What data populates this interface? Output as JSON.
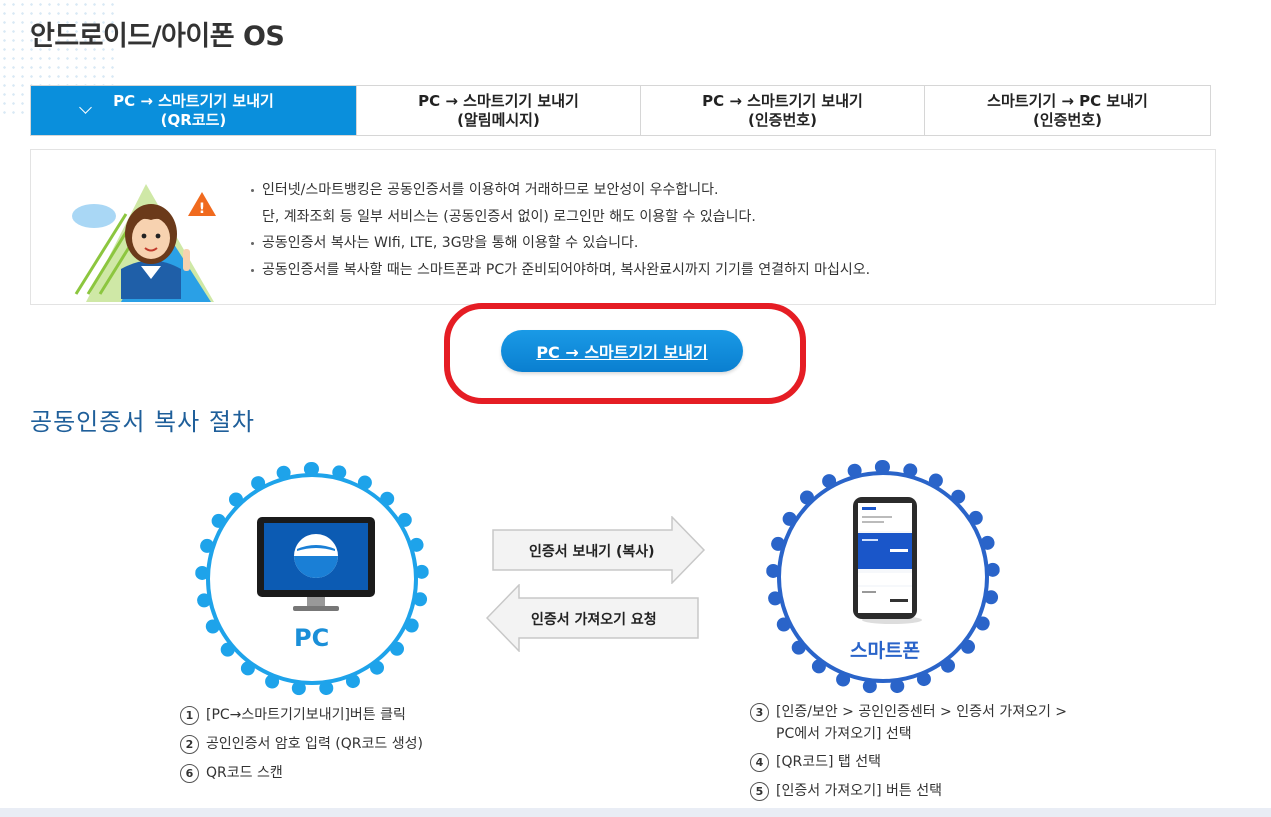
{
  "page_title": "안드로이드/아이폰 OS",
  "tabs": [
    {
      "line1": "PC → 스마트기기 보내기",
      "line2": "(QR코드)",
      "active": true
    },
    {
      "line1": "PC → 스마트기기 보내기",
      "line2": "(알림메시지)",
      "active": false
    },
    {
      "line1": "PC → 스마트기기 보내기",
      "line2": "(인증번호)",
      "active": false
    },
    {
      "line1": "스마트기기 → PC 보내기",
      "line2": "(인증번호)",
      "active": false
    }
  ],
  "info": {
    "line1": "인터넷/스마트뱅킹은 공동인증서를 이용하여 거래하므로 보안성이 우수합니다.",
    "line2": "단, 계좌조회 등 일부 서비스는 (공동인증서 없이) 로그인만 해도 이용할 수 있습니다.",
    "line3": "공동인증서 복사는 WIfi, LTE, 3G망을 통해 이용할 수 있습니다.",
    "line4": "공동인증서를 복사할 때는 스마트폰과 PC가 준비되어야하며, 복사완료시까지 기기를 연결하지 마십시오."
  },
  "send_button": "PC → 스마트기기 보내기",
  "section_title": "공동인증서 복사 절차",
  "diagram": {
    "pc_label": "PC",
    "phone_label": "스마트폰",
    "arrow_right": "인증서 보내기 (복사)",
    "arrow_left": "인증서 가져오기 요청"
  },
  "steps_left": [
    {
      "num": "1",
      "text": "[PC→스마트기기보내기]버튼 클릭"
    },
    {
      "num": "2",
      "text": "공인인증서 암호 입력 (QR코드 생성)"
    },
    {
      "num": "6",
      "text": "QR코드 스캔"
    }
  ],
  "steps_right": [
    {
      "num": "3",
      "text": "[인증/보안 > 공인인증센터 > 인증서 가져오기 >",
      "text2": "PC에서 가져오기] 선택"
    },
    {
      "num": "4",
      "text": "[QR코드] 탭 선택"
    },
    {
      "num": "5",
      "text": "[인증서 가져오기] 버튼 선택"
    }
  ],
  "colors": {
    "tab_active": "#0a8fdc",
    "highlight_ring": "#e51d24",
    "section_title": "#1f5f9a",
    "pc_circle": "#1ea3ea",
    "phone_circle": "#2a64c9"
  }
}
